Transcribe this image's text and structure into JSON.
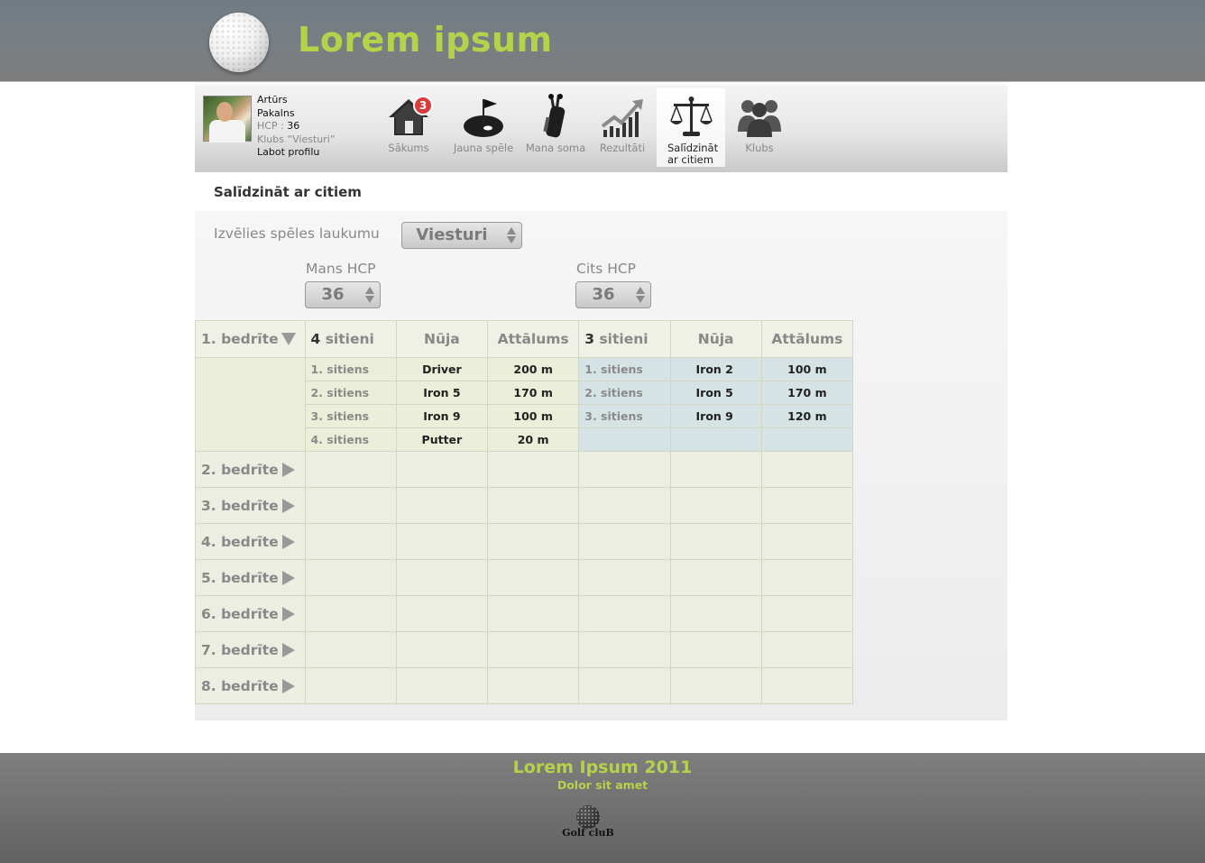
{
  "header": {
    "title": "Lorem ipsum"
  },
  "profile": {
    "first_name": "Artūrs",
    "last_name": "Pakalns",
    "hcp_label": "HCP : ",
    "hcp_value": "36",
    "club": "Klubs “Viesturi”",
    "edit_link": "Labot profilu"
  },
  "nav": {
    "home": {
      "label": "Sākums",
      "badge": "3"
    },
    "new_game": {
      "label": "Jauna spēle"
    },
    "bag": {
      "label": "Mana soma"
    },
    "results": {
      "label": "Rezultāti"
    },
    "compare": {
      "label_line1": "Salīdzināt",
      "label_line2": "ar citiem"
    },
    "clubs": {
      "label": "Klubs"
    }
  },
  "page": {
    "title": "Salīdzināt ar citiem"
  },
  "form": {
    "course_label": "Izvēlies spēles laukumu",
    "course_value": "Viesturi",
    "my_hcp_label": "Mans HCP",
    "my_hcp_value": "36",
    "other_hcp_label": "Cits HCP",
    "other_hcp_value": "36"
  },
  "table": {
    "hole1": {
      "label": "1. bedrīte",
      "mine": {
        "count": "4",
        "count_suffix": " sitieni",
        "club_header": "Nūja",
        "distance_header": "Attālums"
      },
      "other": {
        "count": "3",
        "count_suffix": " sitieni",
        "club_header": "Nūja",
        "distance_header": "Attālums"
      },
      "rows": [
        {
          "mine_shot": "1. sitiens",
          "mine_club": "Driver",
          "mine_dist": "200 m",
          "other_shot": "1. sitiens",
          "other_club": "Iron 2",
          "other_dist": "100 m"
        },
        {
          "mine_shot": "2. sitiens",
          "mine_club": "Iron 5",
          "mine_dist": "170 m",
          "other_shot": "2. sitiens",
          "other_club": "Iron 5",
          "other_dist": "170 m"
        },
        {
          "mine_shot": "3. sitiens",
          "mine_club": "Iron 9",
          "mine_dist": "100 m",
          "other_shot": "3. sitiens",
          "other_club": "Iron 9",
          "other_dist": "120 m"
        },
        {
          "mine_shot": "4. sitiens",
          "mine_club": "Putter",
          "mine_dist": "20 m",
          "other_shot": "",
          "other_club": "",
          "other_dist": ""
        }
      ]
    },
    "holes": [
      "2. bedrīte",
      "3. bedrīte",
      "4. bedrīte",
      "5. bedrīte",
      "6. bedrīte",
      "7. bedrīte",
      "8. bedrīte"
    ]
  },
  "footer": {
    "title": "Lorem Ipsum 2011",
    "subtitle": "Dolor sit amet",
    "logo_text": "Golf cluB"
  },
  "colors": {
    "accent": "#b5d24a",
    "badge": "#d93c3c",
    "mine_bg": "#ebeed9",
    "other_bg": "#d5e3e4"
  }
}
